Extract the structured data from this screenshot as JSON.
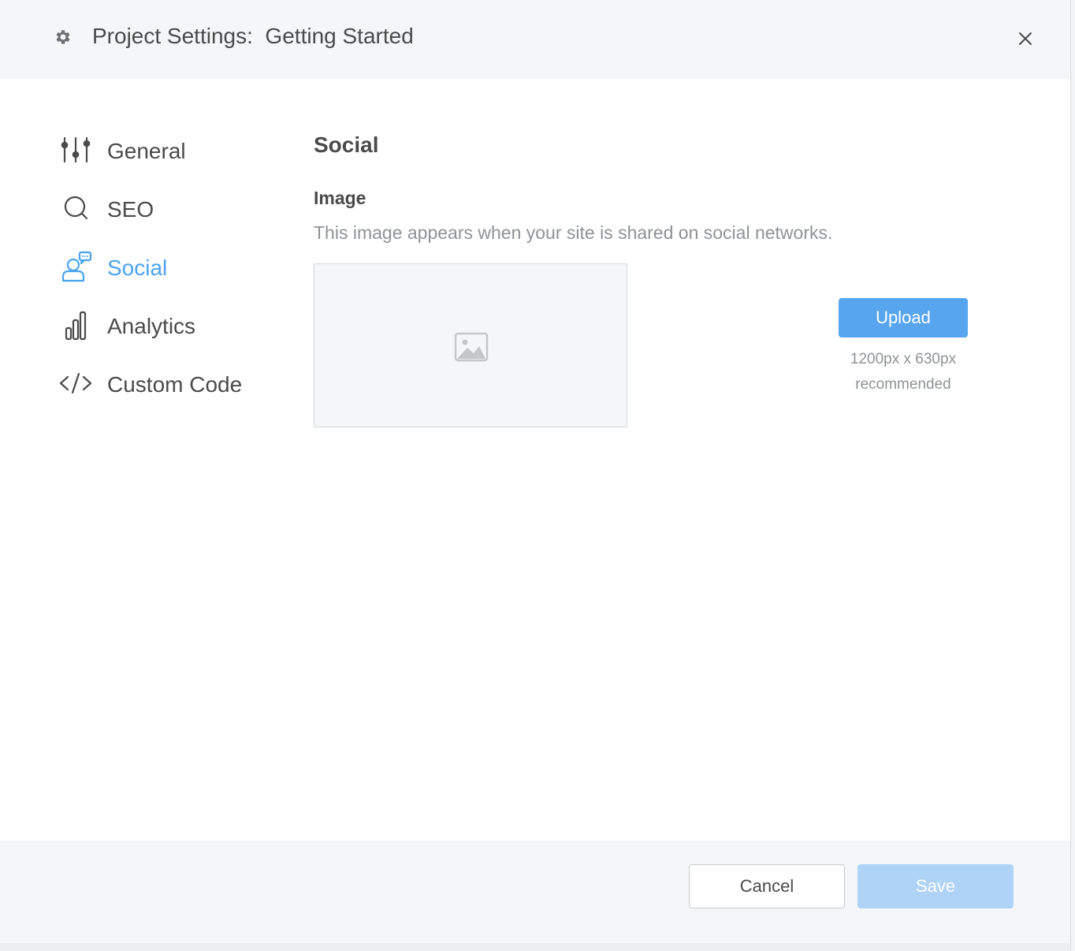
{
  "header": {
    "title": "Project Settings:  Getting Started",
    "gear_icon": "gear-icon",
    "close_icon": "close-icon"
  },
  "nav": {
    "items": [
      {
        "label": "General",
        "icon": "sliders-icon",
        "active": false
      },
      {
        "label": "SEO",
        "icon": "search-icon",
        "active": false
      },
      {
        "label": "Social",
        "icon": "user-chat-icon",
        "active": true
      },
      {
        "label": "Analytics",
        "icon": "bar-chart-icon",
        "active": false
      },
      {
        "label": "Custom Code",
        "icon": "code-icon",
        "active": false
      }
    ]
  },
  "content": {
    "section_title": "Social",
    "image_label": "Image",
    "image_description": "This image appears when your site is shared on social networks.",
    "placeholder_icon": "image-placeholder-icon",
    "upload_label": "Upload",
    "upload_hint_line1": "1200px x 630px",
    "upload_hint_line2": "recommended"
  },
  "footer": {
    "cancel_label": "Cancel",
    "save_label": "Save"
  },
  "colors": {
    "accent": "#4aa3ef",
    "upload_button": "#57a5ee",
    "save_disabled": "#aed3f7",
    "header_bg": "#f5f6f7"
  }
}
